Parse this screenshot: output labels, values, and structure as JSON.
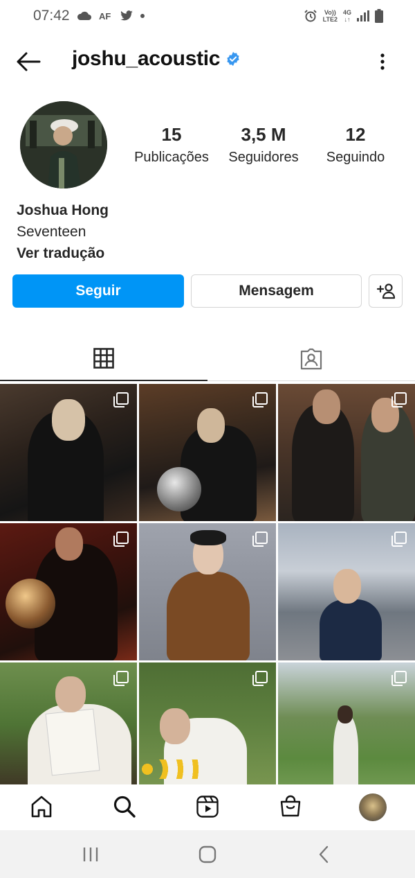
{
  "status_bar": {
    "time": "07:42",
    "network_label": "LTE2",
    "data_label": "4G",
    "volte_label": "Vo))"
  },
  "header": {
    "username": "joshu_acoustic",
    "verified": true,
    "back_icon": "arrow-left-icon",
    "more_icon": "more-vertical-icon"
  },
  "profile": {
    "stats": [
      {
        "value": "15",
        "label": "Publicações"
      },
      {
        "value": "3,5 M",
        "label": "Seguidores"
      },
      {
        "value": "12",
        "label": "Seguindo"
      }
    ],
    "name": "Joshua Hong",
    "bio": "Seventeen",
    "translate_label": "Ver tradução"
  },
  "actions": {
    "follow_label": "Seguir",
    "message_label": "Mensagem",
    "add_user_icon": "add-user-icon"
  },
  "tabs": [
    {
      "name": "posts",
      "icon": "grid-icon",
      "active": true
    },
    {
      "name": "tagged",
      "icon": "tagged-user-icon",
      "active": false
    }
  ],
  "posts": [
    {
      "id": 1,
      "multi": true
    },
    {
      "id": 2,
      "multi": true
    },
    {
      "id": 3,
      "multi": true
    },
    {
      "id": 4,
      "multi": true
    },
    {
      "id": 5,
      "multi": true
    },
    {
      "id": 6,
      "multi": true
    },
    {
      "id": 7,
      "multi": true
    },
    {
      "id": 8,
      "multi": true
    },
    {
      "id": 9,
      "multi": true
    }
  ],
  "bottom_nav": [
    "home-icon",
    "search-icon",
    "reels-icon",
    "shop-icon",
    "profile-avatar"
  ],
  "system_nav": [
    "recent-apps-icon",
    "home-button-icon",
    "back-icon"
  ],
  "colors": {
    "accent": "#0095f6",
    "verified": "#3897f0",
    "text": "#262626",
    "border": "#dbdbdb"
  }
}
